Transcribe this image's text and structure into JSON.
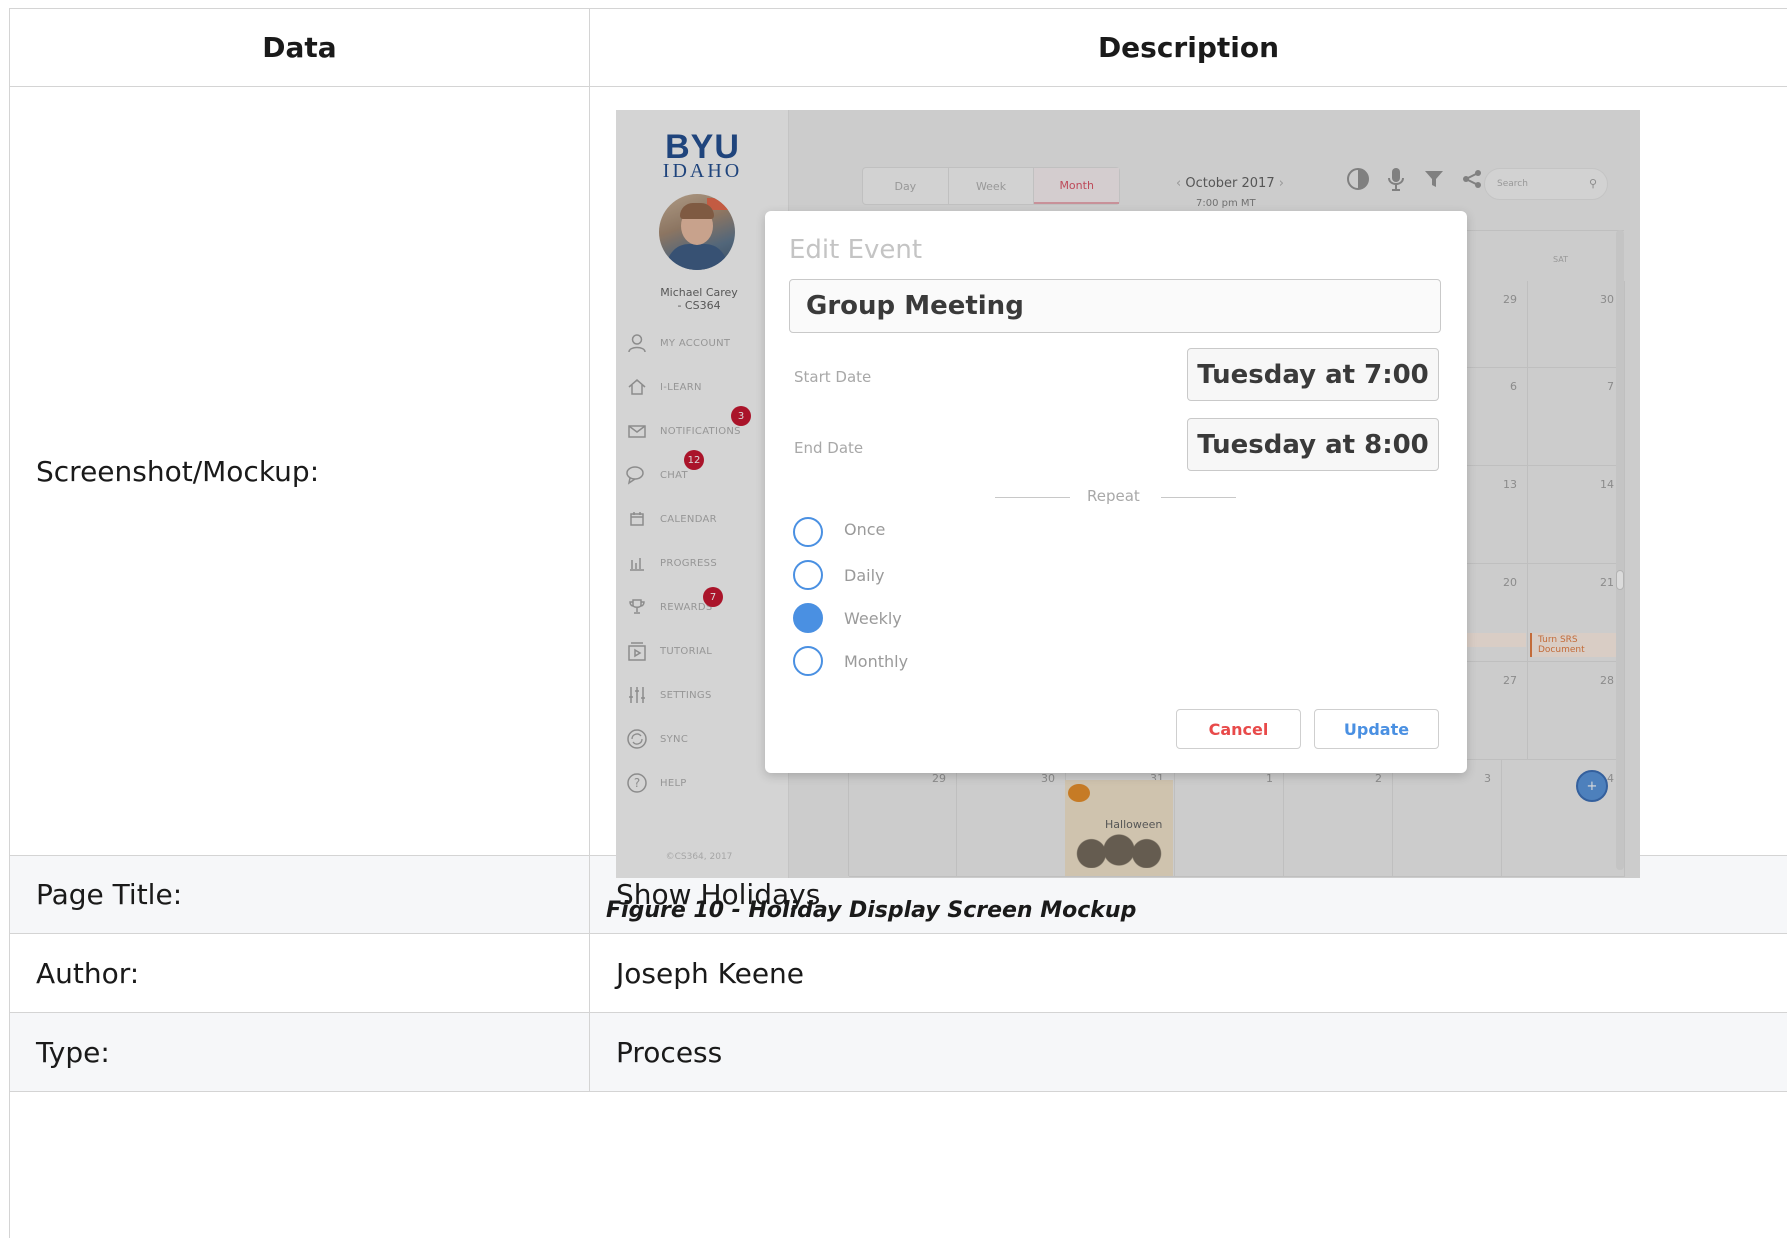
{
  "table": {
    "headers": [
      "Data",
      "Description"
    ],
    "rows": [
      {
        "label": "Screenshot/Mockup:"
      },
      {
        "label": "Page Title:",
        "value": "Show Holidays"
      },
      {
        "label": "Author:",
        "value": "Joseph Keene"
      },
      {
        "label": "Type:",
        "value": "Process"
      }
    ],
    "caption": "Figure 10 - Holiday Display Screen Mockup"
  },
  "mockup": {
    "sidebar": {
      "logo_top": "BYU",
      "logo_bottom": "IDAHO",
      "user_name": "Michael Carey",
      "user_course": "- CS364",
      "nav": [
        {
          "label": "MY ACCOUNT",
          "icon": "user-icon"
        },
        {
          "label": "I-LEARN",
          "icon": "home-icon"
        },
        {
          "label": "NOTIFICATIONS",
          "icon": "envelope-icon",
          "badge": "3"
        },
        {
          "label": "CHAT",
          "icon": "chat-icon",
          "badge": "12"
        },
        {
          "label": "CALENDAR",
          "icon": "calendar-icon"
        },
        {
          "label": "PROGRESS",
          "icon": "bar-chart-icon"
        },
        {
          "label": "REWARDS",
          "icon": "trophy-icon",
          "badge": "7"
        },
        {
          "label": "TUTORIAL",
          "icon": "play-icon"
        },
        {
          "label": "SETTINGS",
          "icon": "sliders-icon"
        },
        {
          "label": "SYNC",
          "icon": "sync-icon"
        },
        {
          "label": "HELP",
          "icon": "help-icon"
        }
      ],
      "copyright": "©CS364, 2017"
    },
    "toolbar": {
      "tabs": [
        "Day",
        "Week",
        "Month"
      ],
      "active_tab": "Month",
      "month": "October 2017",
      "time": "7:00 pm MT",
      "icons": [
        "contrast-icon",
        "microphone-icon",
        "filter-icon",
        "share-icon"
      ],
      "search_placeholder": "Search"
    },
    "calendar": {
      "sat_header": "SAT",
      "right_col_numbers": [
        [
          "29",
          "30"
        ],
        [
          "6",
          "7"
        ],
        [
          "13",
          "14"
        ],
        [
          "20",
          "21"
        ],
        [
          "27",
          "28"
        ]
      ],
      "bottom_row": [
        "29",
        "30",
        "31",
        "1",
        "2",
        "3",
        "4"
      ],
      "holiday": "Halloween",
      "event_partial": "RS",
      "event": "Turn SRS Document"
    },
    "modal": {
      "title": "Edit Event",
      "event_name": "Group Meeting",
      "start_label": "Start Date",
      "start_value": "Tuesday at 7:00",
      "end_label": "End Date",
      "end_value": "Tuesday at 8:00",
      "repeat_label": "Repeat",
      "options": [
        "Once",
        "Daily",
        "Weekly",
        "Monthly"
      ],
      "selected_option": "Weekly",
      "cancel_label": "Cancel",
      "update_label": "Update"
    },
    "fab_symbol": "+",
    "colors": {
      "brand_blue": "#0f3e86",
      "accent_blue": "#4a90e2",
      "danger_red": "#e84a4a",
      "badge_red": "#c0001d",
      "active_tab": "#d9465a"
    }
  }
}
